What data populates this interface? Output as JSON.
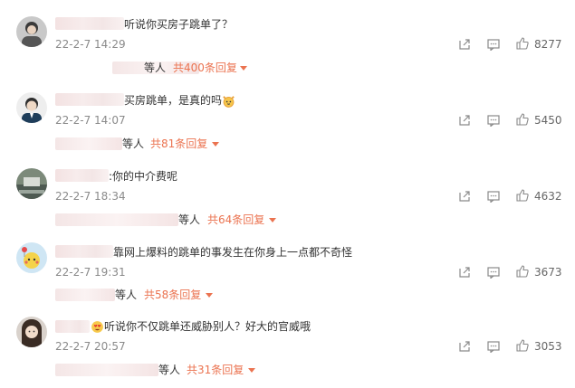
{
  "theme": {
    "accent": "#eb7350",
    "time": "#8a8a8a",
    "text": "#333333",
    "icon": "#8a8a8a"
  },
  "comments": [
    {
      "text": "听说你买房子跳单了？",
      "time": "22-2-7 14:29",
      "likes": "8277",
      "reply_people": "等人",
      "reply_count": "共400条回复"
    },
    {
      "text": "买房跳单，是真的吗",
      "emoji": "cat-face-emoji",
      "time": "22-2-7 14:07",
      "likes": "5450",
      "reply_people": "等人",
      "reply_count": "共81条回复"
    },
    {
      "text": ":你的中介费呢",
      "time": "22-2-7 18:34",
      "likes": "4632",
      "reply_people": "等人",
      "reply_count": "共64条回复"
    },
    {
      "text": "靠网上爆料的跳单的事发生在你身上一点都不奇怪",
      "time": "22-2-7 19:31",
      "likes": "3673",
      "reply_people": "等人",
      "reply_count": "共58条回复"
    },
    {
      "text": "听说你不仅跳单还威胁别人？好大的官威哦",
      "emoji": "heart-eyes-emoji",
      "time": "22-2-7 20:57",
      "likes": "3053",
      "reply_people": "等人",
      "reply_count": "共31条回复"
    }
  ],
  "icons": {
    "share": "share-icon",
    "comment": "comment-icon",
    "like": "thumbs-up-icon"
  }
}
